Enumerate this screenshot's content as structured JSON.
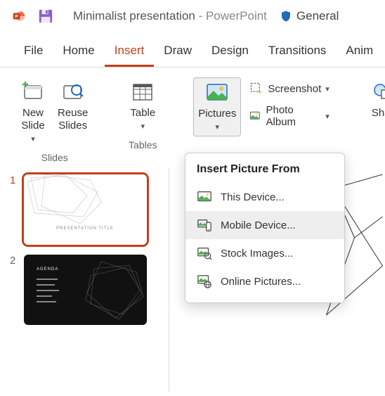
{
  "titlebar": {
    "doc_title": "Minimalist presentation",
    "separator": " - ",
    "app_name": "PowerPoint",
    "sensitivity": "General"
  },
  "ribbon_tabs": [
    "File",
    "Home",
    "Insert",
    "Draw",
    "Design",
    "Transitions",
    "Anim"
  ],
  "active_tab_index": 2,
  "ribbon": {
    "new_slide": "New\nSlide",
    "reuse_slides": "Reuse\nSlides",
    "slides_group": "Slides",
    "table": "Table",
    "tables_group": "Tables",
    "pictures": "Pictures",
    "screenshot": "Screenshot",
    "photo_album": "Photo Album",
    "shapes": "Shap"
  },
  "dropdown": {
    "header": "Insert Picture From",
    "items": [
      "This Device...",
      "Mobile Device...",
      "Stock Images...",
      "Online Pictures..."
    ],
    "hover_index": 1
  },
  "thumbnails": [
    {
      "num": "1",
      "title": "PRESENTATION TITLE",
      "active": true
    },
    {
      "num": "2",
      "title": "AGENDA",
      "active": false
    }
  ]
}
